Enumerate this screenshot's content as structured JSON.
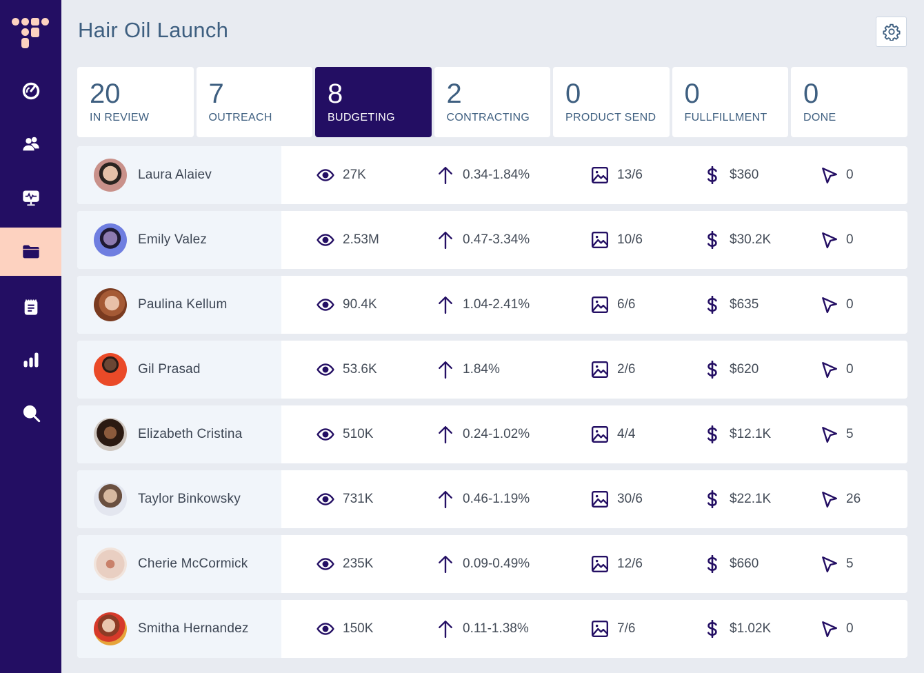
{
  "app": {
    "brand_color": "#230e63",
    "accent_color": "#fdd2c0",
    "logo_icon": "logo-icon"
  },
  "sidebar": {
    "items": [
      {
        "name": "dashboard",
        "icon": "speedometer-icon",
        "active": false
      },
      {
        "name": "people",
        "icon": "users-icon",
        "active": false
      },
      {
        "name": "monitor",
        "icon": "monitor-pulse-icon",
        "active": false
      },
      {
        "name": "campaigns",
        "icon": "folder-icon",
        "active": true
      },
      {
        "name": "notes",
        "icon": "notepad-icon",
        "active": false
      },
      {
        "name": "analytics",
        "icon": "bar-chart-icon",
        "active": false
      },
      {
        "name": "search",
        "icon": "search-icon",
        "active": false
      }
    ]
  },
  "header": {
    "title": "Hair Oil Launch",
    "settings_icon": "gear-icon"
  },
  "stages": [
    {
      "count": "20",
      "label": "IN REVIEW",
      "active": false
    },
    {
      "count": "7",
      "label": "OUTREACH",
      "active": false
    },
    {
      "count": "8",
      "label": "BUDGETING",
      "active": true
    },
    {
      "count": "2",
      "label": "CONTRACTING",
      "active": false
    },
    {
      "count": "0",
      "label": "PRODUCT SEND",
      "active": false
    },
    {
      "count": "0",
      "label": "FULLFILLMENT",
      "active": false
    },
    {
      "count": "0",
      "label": "DONE",
      "active": false
    }
  ],
  "influencers": [
    {
      "name": "Laura Alaiev",
      "views": "27K",
      "engagement": "0.34-1.84%",
      "posts": "13/6",
      "cost": "$360",
      "clicks": "0"
    },
    {
      "name": "Emily Valez",
      "views": "2.53M",
      "engagement": "0.47-3.34%",
      "posts": "10/6",
      "cost": "$30.2K",
      "clicks": "0"
    },
    {
      "name": "Paulina Kellum",
      "views": "90.4K",
      "engagement": "1.04-2.41%",
      "posts": "6/6",
      "cost": "$635",
      "clicks": "0"
    },
    {
      "name": "Gil Prasad",
      "views": "53.6K",
      "engagement": "1.84%",
      "posts": "2/6",
      "cost": "$620",
      "clicks": "0"
    },
    {
      "name": "Elizabeth Cristina",
      "views": "510K",
      "engagement": "0.24-1.02%",
      "posts": "4/4",
      "cost": "$12.1K",
      "clicks": "5"
    },
    {
      "name": "Taylor Binkowsky",
      "views": "731K",
      "engagement": "0.46-1.19%",
      "posts": "30/6",
      "cost": "$22.1K",
      "clicks": "26"
    },
    {
      "name": "Cherie McCormick",
      "views": "235K",
      "engagement": "0.09-0.49%",
      "posts": "12/6",
      "cost": "$660",
      "clicks": "5"
    },
    {
      "name": "Smitha Hernandez",
      "views": "150K",
      "engagement": "0.11-1.38%",
      "posts": "7/6",
      "cost": "$1.02K",
      "clicks": "0"
    }
  ],
  "metric_icons": [
    "eye-icon",
    "arrow-up-icon",
    "image-icon",
    "dollar-icon",
    "cursor-icon"
  ]
}
